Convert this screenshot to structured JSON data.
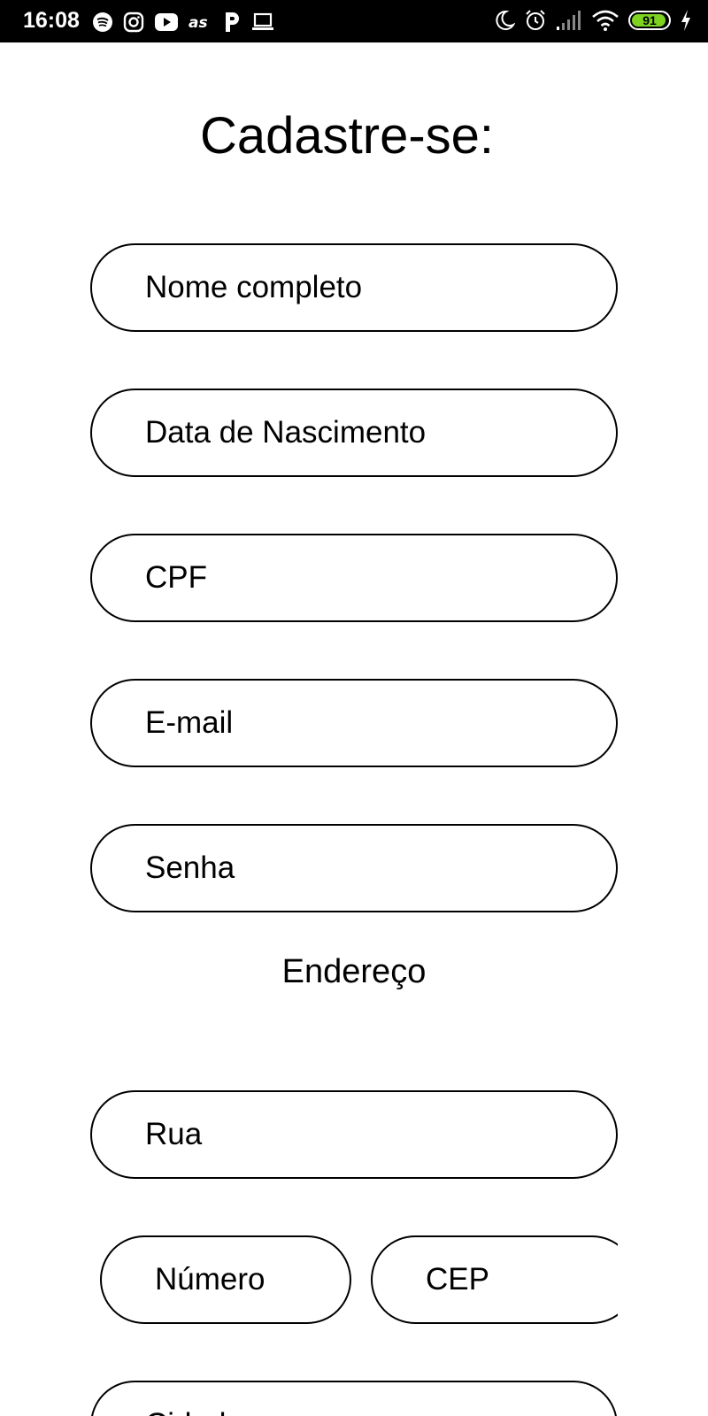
{
  "status_bar": {
    "time": "16:08",
    "left_icons": [
      "spotify-icon",
      "instagram-icon",
      "youtube-icon",
      "lastfm-icon",
      "pandora-icon",
      "laptop-icon"
    ],
    "right_icons": [
      "moon-icon",
      "alarm-icon",
      "signal-icon",
      "wifi-icon",
      "battery-icon",
      "charging-icon"
    ],
    "battery_level": "91",
    "battery_color": "#7ed321"
  },
  "form": {
    "title": "Cadastre-se:",
    "fields": {
      "name": "Nome completo",
      "birth": "Data de Nascimento",
      "cpf": "CPF",
      "email": "E-mail",
      "password": "Senha"
    },
    "address_label": "Endereço",
    "address_fields": {
      "street": "Rua",
      "number": "Número",
      "cep": "CEP",
      "city": "Cidade"
    }
  }
}
